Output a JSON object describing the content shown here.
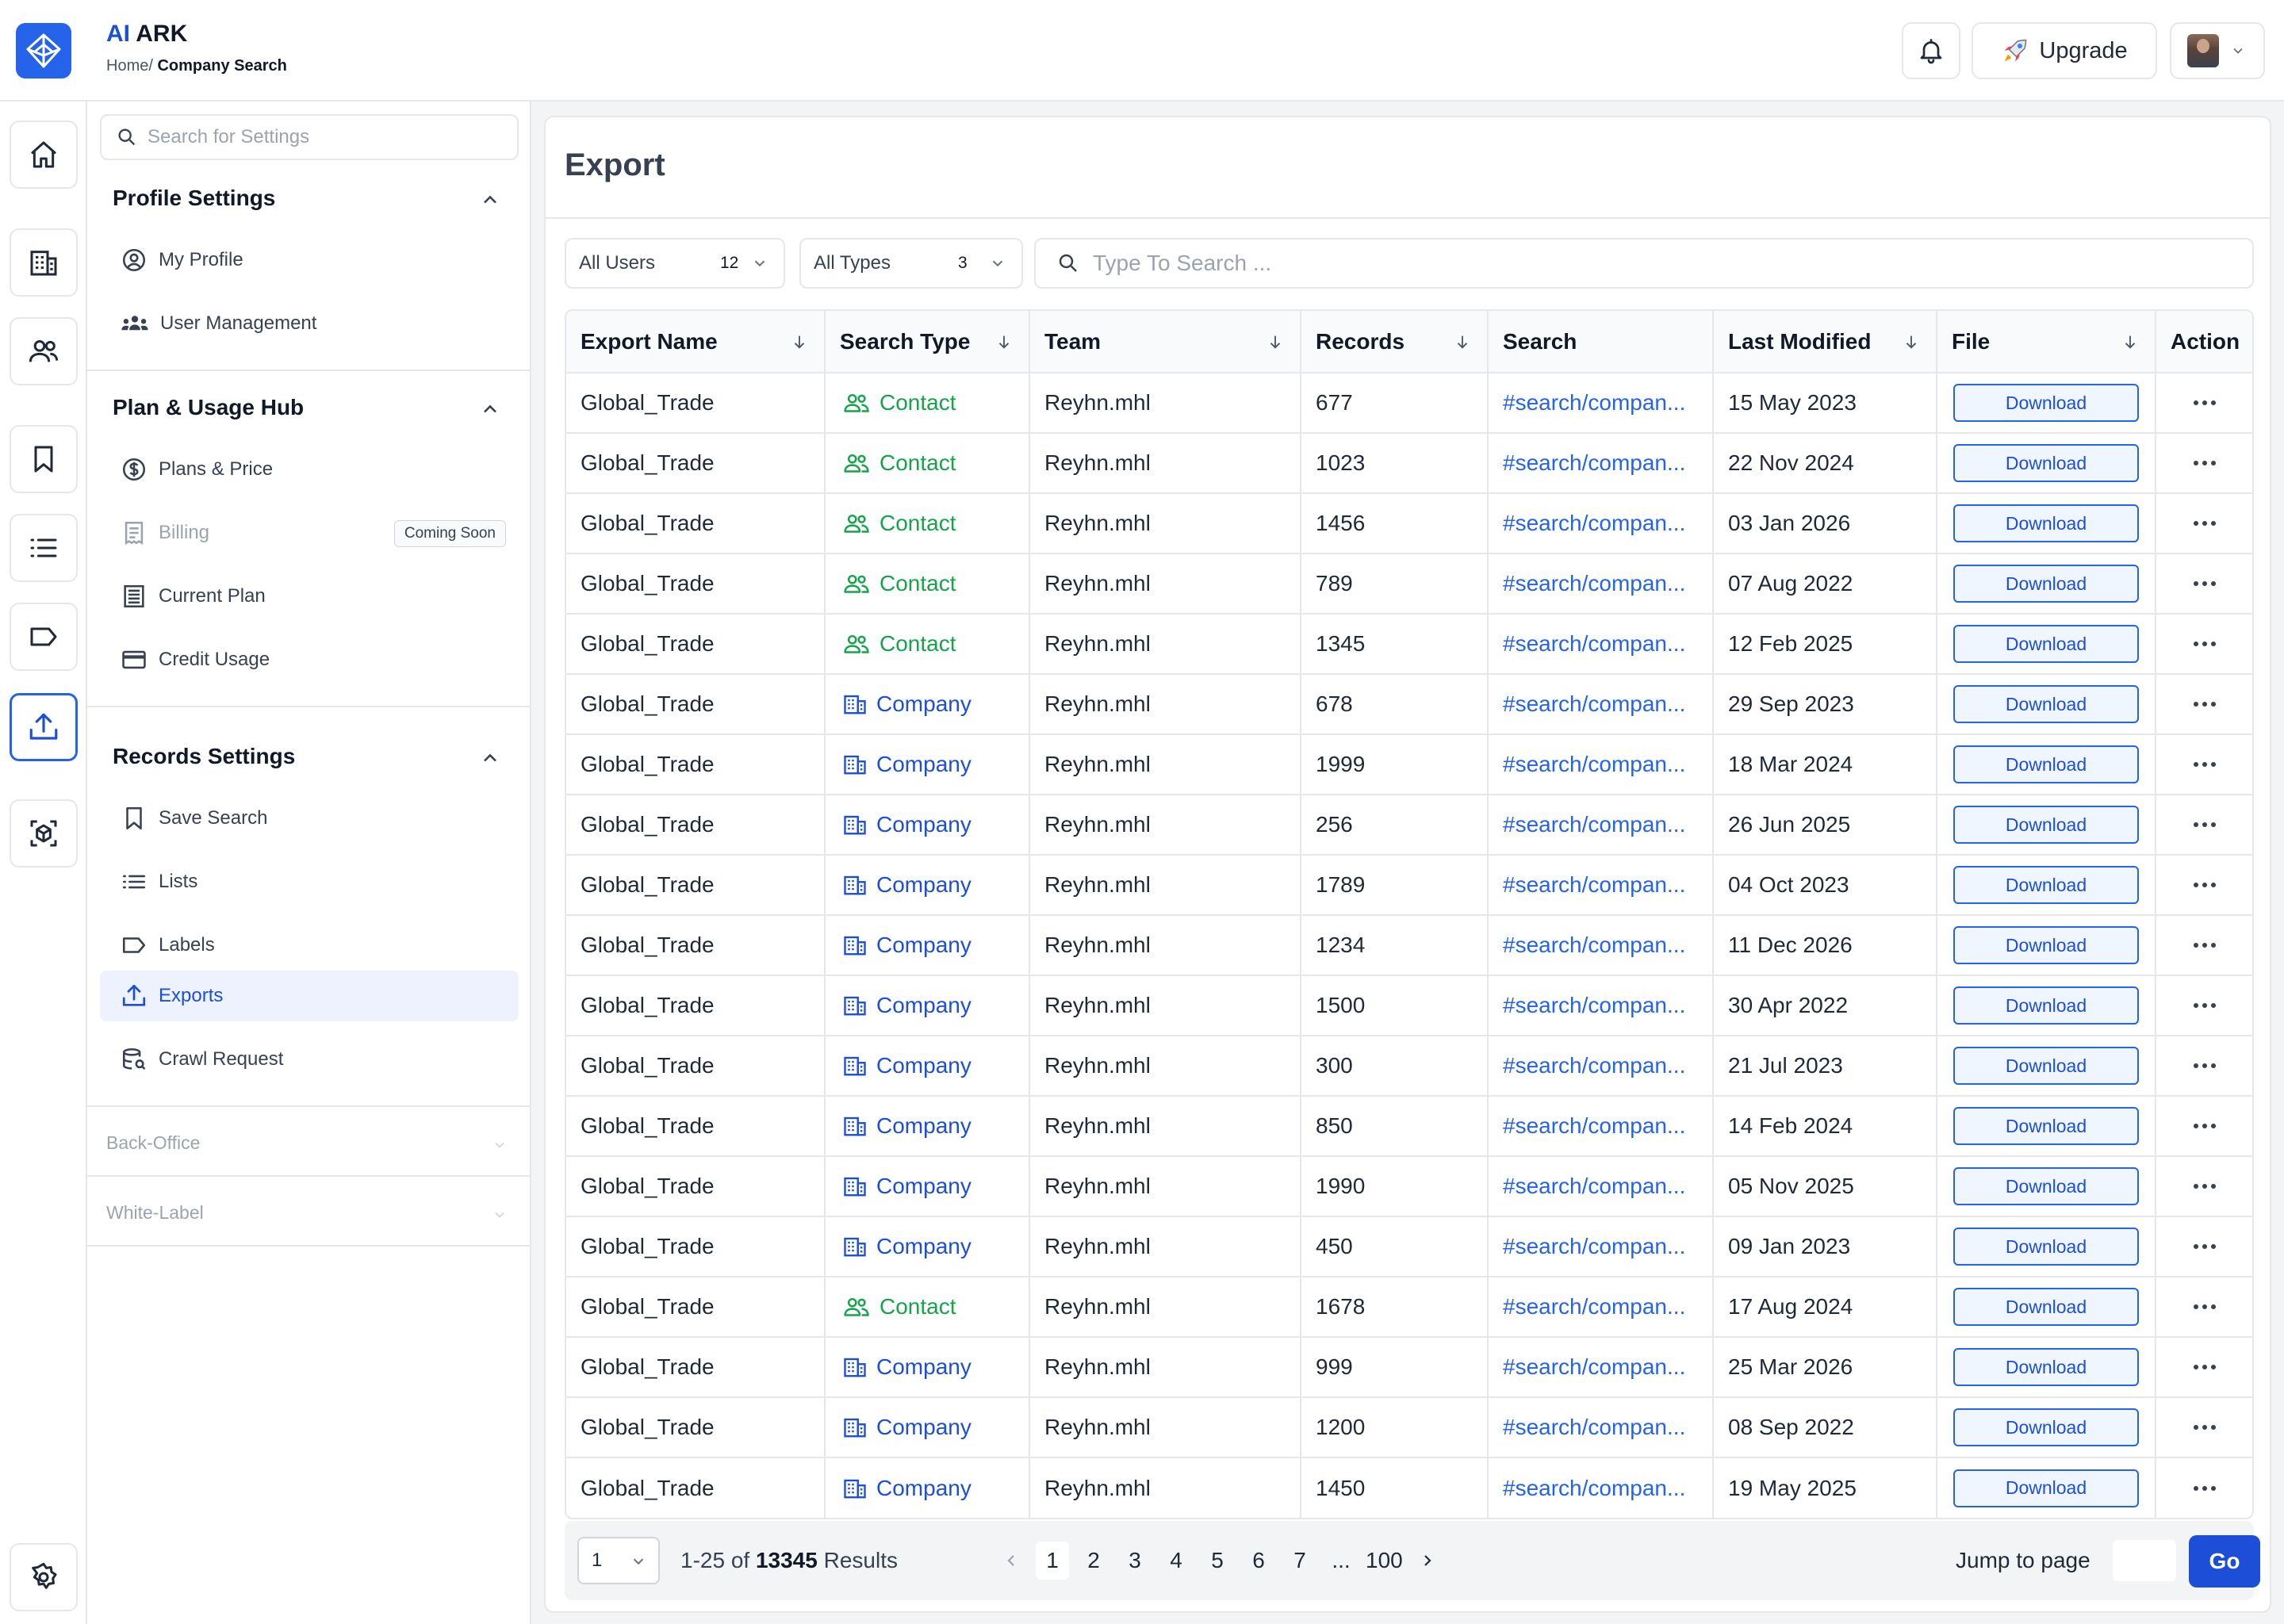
{
  "header": {
    "brand_ai": "AI",
    "brand_name": "ARK",
    "breadcrumb_home": "Home/",
    "breadcrumb_current": "Company Search",
    "upgrade_label": "Upgrade"
  },
  "sidebar": {
    "search_placeholder": "Search for Settings",
    "sections": [
      {
        "title": "Profile Settings",
        "items": [
          {
            "label": "My Profile",
            "icon": "user-circle-icon"
          },
          {
            "label": "User Management",
            "icon": "users-icon"
          }
        ]
      },
      {
        "title": "Plan & Usage Hub",
        "items": [
          {
            "label": "Plans & Price",
            "icon": "dollar-circle-icon"
          },
          {
            "label": "Billing",
            "icon": "receipt-icon",
            "badge": "Coming Soon",
            "disabled": true
          },
          {
            "label": "Current Plan",
            "icon": "document-list-icon"
          },
          {
            "label": "Credit Usage",
            "icon": "credit-card-icon"
          }
        ]
      },
      {
        "title": "Records Settings",
        "items": [
          {
            "label": "Save Search",
            "icon": "bookmark-icon"
          },
          {
            "label": "Lists",
            "icon": "list-icon"
          },
          {
            "label": "Labels",
            "icon": "label-icon"
          },
          {
            "label": "Exports",
            "icon": "upload-icon",
            "active": true
          },
          {
            "label": "Crawl Request",
            "icon": "database-search-icon"
          }
        ]
      }
    ],
    "collapsed": [
      "Back-Office",
      "White-Label"
    ]
  },
  "main": {
    "title": "Export",
    "filters": {
      "users_label": "All Users",
      "users_count": "12",
      "types_label": "All Types",
      "types_count": "3",
      "search_placeholder": "Type To Search ..."
    },
    "table": {
      "headers": [
        "Export Name",
        "Search Type",
        "Team",
        "Records",
        "Search",
        "Last Modified",
        "File",
        "Action"
      ],
      "download_label": "Download",
      "rows": [
        {
          "name": "Global_Trade",
          "type": "Contact",
          "team": "Reyhn.mhl",
          "records": "677",
          "search": "#search/compan...",
          "modified": "15 May 2023"
        },
        {
          "name": "Global_Trade",
          "type": "Contact",
          "team": "Reyhn.mhl",
          "records": "1023",
          "search": "#search/compan...",
          "modified": "22 Nov 2024"
        },
        {
          "name": "Global_Trade",
          "type": "Contact",
          "team": "Reyhn.mhl",
          "records": "1456",
          "search": "#search/compan...",
          "modified": "03 Jan 2026"
        },
        {
          "name": "Global_Trade",
          "type": "Contact",
          "team": "Reyhn.mhl",
          "records": "789",
          "search": "#search/compan...",
          "modified": "07 Aug 2022"
        },
        {
          "name": "Global_Trade",
          "type": "Contact",
          "team": "Reyhn.mhl",
          "records": "1345",
          "search": "#search/compan...",
          "modified": "12 Feb 2025"
        },
        {
          "name": "Global_Trade",
          "type": "Company",
          "team": "Reyhn.mhl",
          "records": "678",
          "search": "#search/compan...",
          "modified": "29 Sep 2023"
        },
        {
          "name": "Global_Trade",
          "type": "Company",
          "team": "Reyhn.mhl",
          "records": "1999",
          "search": "#search/compan...",
          "modified": "18 Mar 2024"
        },
        {
          "name": "Global_Trade",
          "type": "Company",
          "team": "Reyhn.mhl",
          "records": "256",
          "search": "#search/compan...",
          "modified": "26 Jun 2025"
        },
        {
          "name": "Global_Trade",
          "type": "Company",
          "team": "Reyhn.mhl",
          "records": "1789",
          "search": "#search/compan...",
          "modified": "04 Oct 2023"
        },
        {
          "name": "Global_Trade",
          "type": "Company",
          "team": "Reyhn.mhl",
          "records": "1234",
          "search": "#search/compan...",
          "modified": "11 Dec 2026"
        },
        {
          "name": "Global_Trade",
          "type": "Company",
          "team": "Reyhn.mhl",
          "records": "1500",
          "search": "#search/compan...",
          "modified": "30 Apr 2022"
        },
        {
          "name": "Global_Trade",
          "type": "Company",
          "team": "Reyhn.mhl",
          "records": "300",
          "search": "#search/compan...",
          "modified": "21 Jul 2023"
        },
        {
          "name": "Global_Trade",
          "type": "Company",
          "team": "Reyhn.mhl",
          "records": "850",
          "search": "#search/compan...",
          "modified": "14 Feb 2024"
        },
        {
          "name": "Global_Trade",
          "type": "Company",
          "team": "Reyhn.mhl",
          "records": "1990",
          "search": "#search/compan...",
          "modified": "05 Nov 2025"
        },
        {
          "name": "Global_Trade",
          "type": "Company",
          "team": "Reyhn.mhl",
          "records": "450",
          "search": "#search/compan...",
          "modified": "09 Jan 2023"
        },
        {
          "name": "Global_Trade",
          "type": "Contact",
          "team": "Reyhn.mhl",
          "records": "1678",
          "search": "#search/compan...",
          "modified": "17 Aug 2024"
        },
        {
          "name": "Global_Trade",
          "type": "Company",
          "team": "Reyhn.mhl",
          "records": "999",
          "search": "#search/compan...",
          "modified": "25 Mar 2026"
        },
        {
          "name": "Global_Trade",
          "type": "Company",
          "team": "Reyhn.mhl",
          "records": "1200",
          "search": "#search/compan...",
          "modified": "08 Sep 2022"
        },
        {
          "name": "Global_Trade",
          "type": "Company",
          "team": "Reyhn.mhl",
          "records": "1450",
          "search": "#search/compan...",
          "modified": "19 May 2025"
        }
      ]
    },
    "pagination": {
      "per_page_value": "1",
      "range": "1-25 of",
      "total": "13345",
      "results_word": "Results",
      "pages": [
        "1",
        "2",
        "3",
        "4",
        "5",
        "6",
        "7"
      ],
      "ellipsis": "...",
      "last_page": "100",
      "current_page": "1",
      "jump_label": "Jump to page",
      "go_label": "Go"
    }
  },
  "colors": {
    "accent": "#2563eb",
    "contact": "#16a34a",
    "company": "#1d4ed8"
  }
}
